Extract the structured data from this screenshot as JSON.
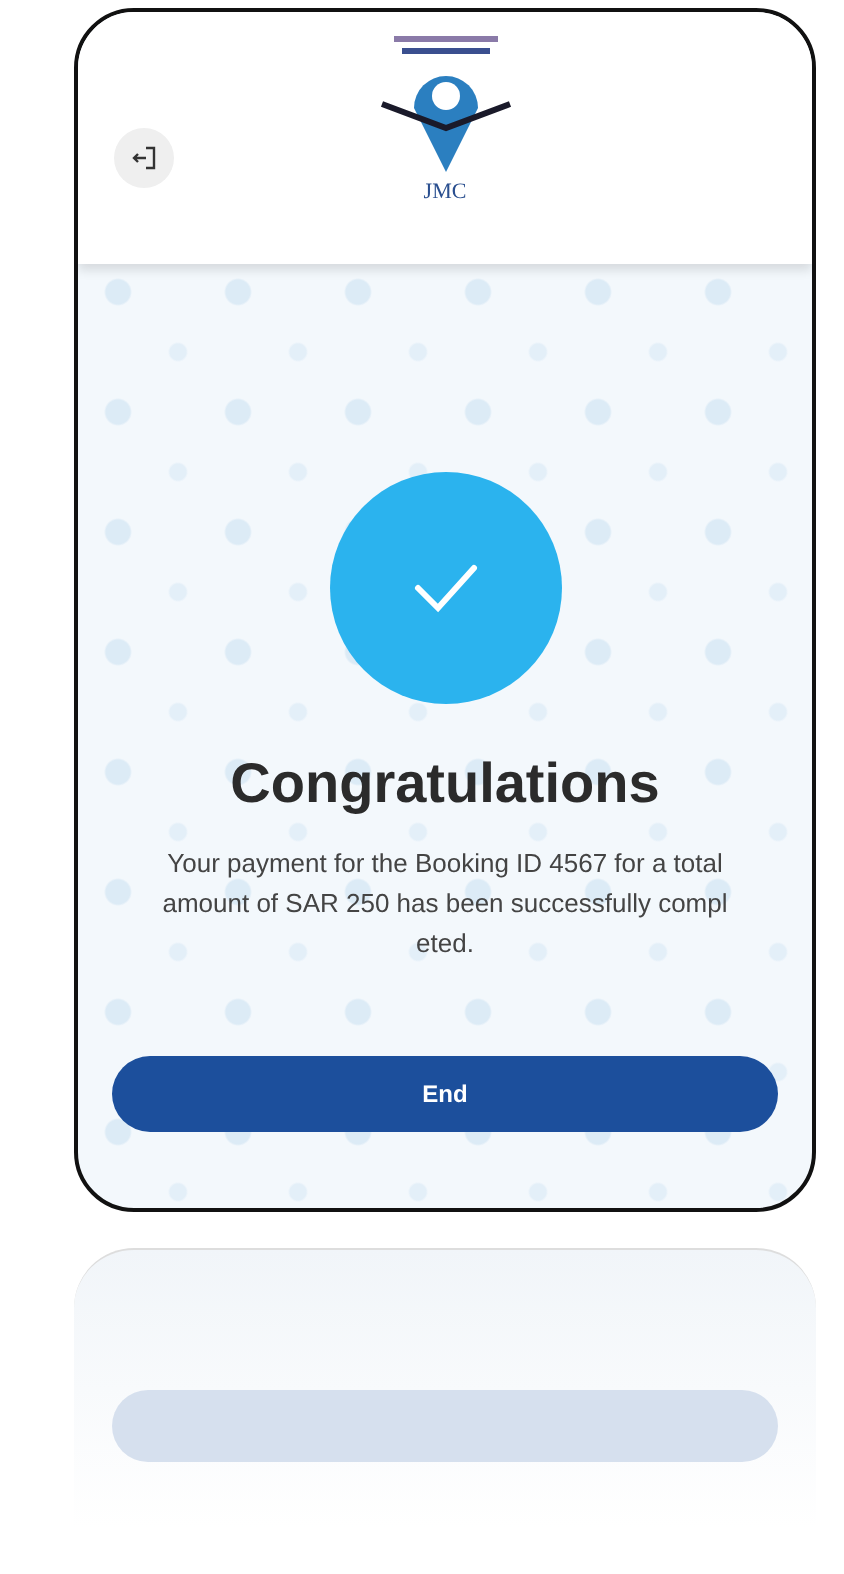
{
  "header": {
    "logo_text": "JMC"
  },
  "success": {
    "title": "Congratulations",
    "message": "Your payment for the Booking ID 4567 for a total amount of SAR 250 has been successfully compl eted."
  },
  "button": {
    "label": "End"
  }
}
